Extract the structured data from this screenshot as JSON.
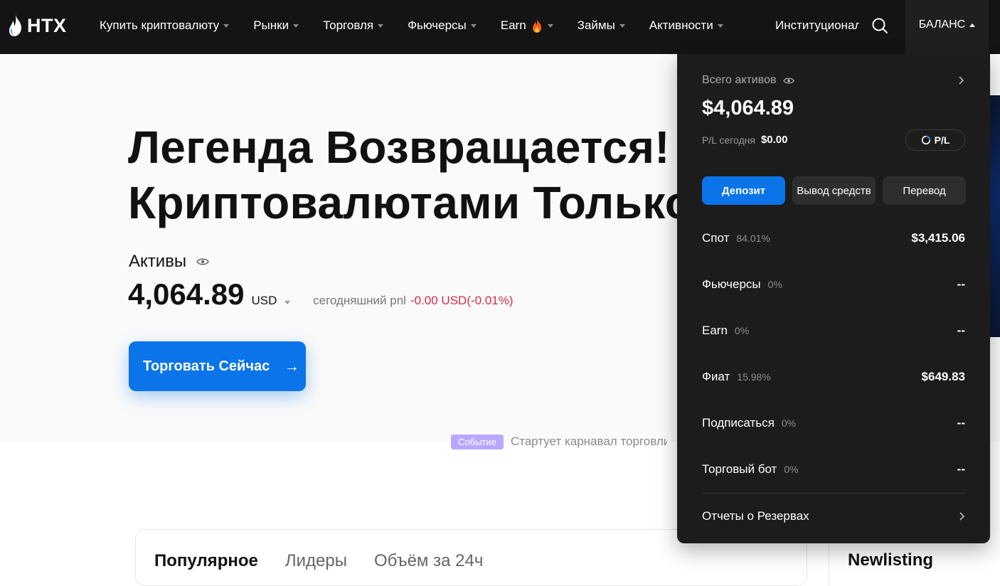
{
  "nav": {
    "logo_text": "HTX",
    "items": [
      {
        "label": "Купить криптовалюту",
        "has_caret": true
      },
      {
        "label": "Рынки",
        "has_caret": true
      },
      {
        "label": "Торговля",
        "has_caret": true
      },
      {
        "label": "Фьючерсы",
        "has_caret": true
      },
      {
        "label": "Earn",
        "has_caret": true,
        "icon": "fire-icon"
      },
      {
        "label": "Займы",
        "has_caret": true
      },
      {
        "label": "Активности",
        "has_caret": true
      }
    ],
    "clipped_item": "Институциональные",
    "search_icon": "search-icon",
    "balance_label": "БАЛАНС"
  },
  "hero": {
    "title_line1": "Легенда Возвращается!",
    "title_line2": "Криптовалютами Только",
    "assets_label": "Активы",
    "assets_value": "4,064.89",
    "assets_currency": "USD",
    "pnl_label": "сегодняшний pnl",
    "pnl_value": "-0.00 USD(-0.01%)",
    "trade_button": "Торговать Сейчас",
    "trade_arrow": "→"
  },
  "event": {
    "badge": "Событие",
    "text": "Стартует карнавал торговли"
  },
  "markets": {
    "tabs": [
      "Популярное",
      "Лидеры",
      "Объём за 24ч"
    ],
    "side_title": "Newlisting"
  },
  "balance_panel": {
    "total_label": "Всего активов",
    "total_value": "$4,064.89",
    "pl_label": "P/L сегодня",
    "pl_value": "$0.00",
    "pl_button": "P/L",
    "actions": [
      "Депозит",
      "Вывод средств",
      "Перевод"
    ],
    "rows": [
      {
        "name": "Спот",
        "pct": "84.01%",
        "value": "$3,415.06"
      },
      {
        "name": "Фьючерсы",
        "pct": "0%",
        "value": "--"
      },
      {
        "name": "Earn",
        "pct": "0%",
        "value": "--"
      },
      {
        "name": "Фиат",
        "pct": "15.98%",
        "value": "$649.83"
      },
      {
        "name": "Подписаться",
        "pct": "0%",
        "value": "--"
      },
      {
        "name": "Торговый бот",
        "pct": "0%",
        "value": "--"
      }
    ],
    "reserves_label": "Отчеты о Резервах"
  },
  "colors": {
    "nav_bg": "#141414",
    "accent_blue": "#0a74e8",
    "panel_bg": "#1c1c1c",
    "pnl_negative": "#e0284a",
    "event_badge": "#b9a8ff"
  }
}
